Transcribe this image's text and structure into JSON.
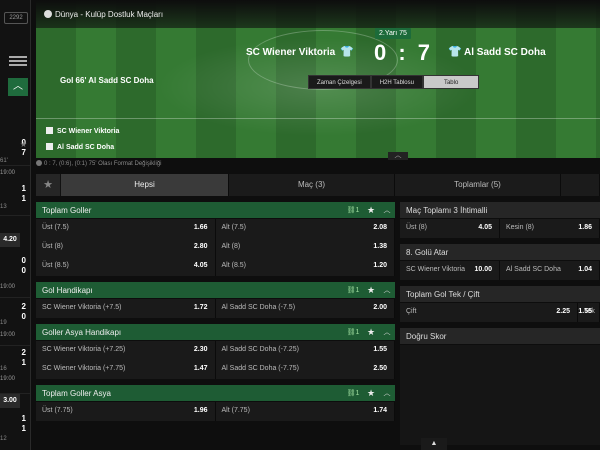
{
  "rail": {
    "badge": "2292",
    "items": [
      {
        "score_a": "0",
        "score_b": "7",
        "minute": "61'",
        "time": "19:00"
      },
      {
        "score_a": "1",
        "score_b": "1",
        "minute": "13",
        "time": "19:00"
      },
      {
        "score_a": "0",
        "score_b": "0",
        "minute": "",
        "time": "19:00"
      },
      {
        "score_a": "2",
        "score_b": "0",
        "minute": "19",
        "time": "19:00"
      },
      {
        "score_a": "2",
        "score_b": "1",
        "minute": "16",
        "time": "19:00"
      },
      {
        "score_a": "1",
        "score_b": "1",
        "minute": "12",
        "time": "19:00"
      }
    ],
    "odd_1": "4.20",
    "odd_2": "3.00"
  },
  "header": {
    "competition": "Dünya - Kulüp Dostluk Maçları",
    "period": "2.Yarı 75",
    "home_team": "SC Wiener Viktoria",
    "away_team": "Al Sadd SC Doha",
    "score": "0 : 7",
    "last_goal": "Gol 66' Al Sadd SC Doha",
    "tabs": [
      "Zaman Çizelgesi",
      "H2H Tablosu",
      "Tablo"
    ],
    "lineup_home": "SC Wiener Viktoria",
    "lineup_away": "Al Sadd SC Doha"
  },
  "info_line": "0 : 7, (0:6), (0:1) 75' Olası Format Değişikliği",
  "tabs": [
    "Hepsi",
    "Maç (3)",
    "Toplamlar (5)"
  ],
  "left_markets": [
    {
      "title": "Toplam Goller",
      "count": "1",
      "rows": [
        {
          "l1": "Üst (7.5)",
          "o1": "1.66",
          "l2": "Alt (7.5)",
          "o2": "2.08"
        },
        {
          "l1": "Üst (8)",
          "o1": "2.80",
          "l2": "Alt (8)",
          "o2": "1.38"
        },
        {
          "l1": "Üst (8.5)",
          "o1": "4.05",
          "l2": "Alt (8.5)",
          "o2": "1.20"
        }
      ]
    },
    {
      "title": "Gol Handikapı",
      "count": "1",
      "rows": [
        {
          "l1": "SC Wiener Viktoria (+7.5)",
          "o1": "1.72",
          "l2": "Al Sadd SC Doha (-7.5)",
          "o2": "2.00"
        }
      ]
    },
    {
      "title": "Goller Asya Handikapı",
      "count": "1",
      "rows": [
        {
          "l1": "SC Wiener Viktoria (+7.25)",
          "o1": "2.30",
          "l2": "Al Sadd SC Doha (-7.25)",
          "o2": "1.55"
        },
        {
          "l1": "SC Wiener Viktoria (+7.75)",
          "o1": "1.47",
          "l2": "Al Sadd SC Doha (-7.75)",
          "o2": "2.50"
        }
      ]
    },
    {
      "title": "Toplam Goller Asya",
      "count": "1",
      "rows": [
        {
          "l1": "Üst (7.75)",
          "o1": "1.96",
          "l2": "Alt (7.75)",
          "o2": "1.74"
        }
      ]
    }
  ],
  "right_markets": {
    "m1_title": "Maç Toplamı 3 İhtimalli",
    "m1_l1": "Üst (8)",
    "m1_o1": "4.05",
    "m1_l2": "Kesin (8)",
    "m1_o2": "1.86",
    "m2_title": "8. Golü Atar",
    "m2_l1": "SC Wiener Viktoria",
    "m2_o1": "10.00",
    "m2_l2": "Al Sadd SC Doha",
    "m2_o2": "1.04",
    "m3_title": "Toplam Gol Tek / Çift",
    "m3_l1": "Çift",
    "m3_o1": "2.25",
    "m3_l2": "Tek",
    "m3_o2": "1.55",
    "m4_title": "Doğru Skor"
  },
  "colors": {
    "market_green": "#1e5c34",
    "accent": "#1c6b3a"
  }
}
